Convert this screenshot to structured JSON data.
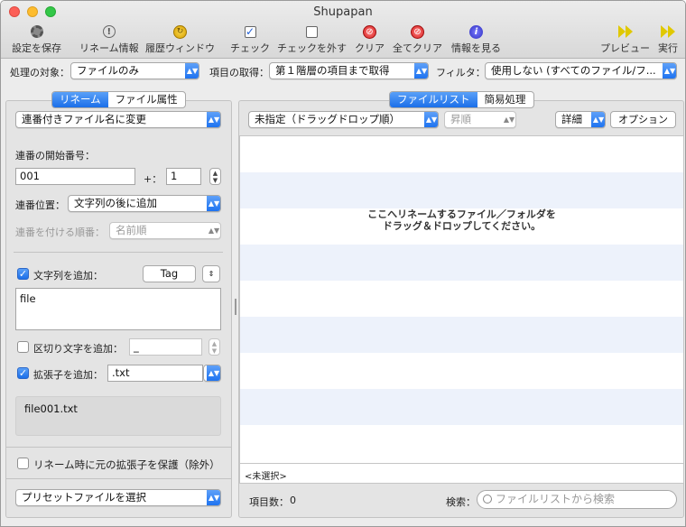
{
  "window": {
    "title": "Shupapan"
  },
  "toolbar": {
    "save_settings": "設定を保存",
    "rename_info": "リネーム情報",
    "history_window": "履歴ウィンドウ",
    "check": "チェック",
    "uncheck": "チェックを外す",
    "clear": "クリア",
    "clear_all": "全てクリア",
    "view_info": "情報を見る",
    "preview": "プレビュー",
    "run": "実行"
  },
  "options_bar": {
    "target_label": "処理の対象：",
    "target_value": "ファイルのみ",
    "fetch_label": "項目の取得：",
    "fetch_value": "第１階層の項目まで取得",
    "filter_label": "フィルタ：",
    "filter_value": "使用しない (すべてのファイル/フ..."
  },
  "left": {
    "tabs": [
      "リネーム",
      "ファイル属性"
    ],
    "active_tab": 0,
    "mode_value": "連番付きファイル名に変更",
    "start_number_label": "連番の開始番号：",
    "start_number_value": "001",
    "plus_label": "+：",
    "increment_value": "1",
    "position_label": "連番位置：",
    "position_value": "文字列の後に追加",
    "order_label": "連番を付ける順番：",
    "order_value": "名前順",
    "add_string_label": "文字列を追加：",
    "add_string_checked": true,
    "tag_button": "Tag",
    "string_value": "file",
    "separator_label": "区切り文字を追加：",
    "separator_checked": false,
    "separator_value": "_",
    "extension_label": "拡張子を追加：",
    "extension_checked": true,
    "extension_value": ".txt",
    "preview_value": "file001.txt",
    "protect_ext_label": "リネーム時に元の拡張子を保護（除外）",
    "protect_ext_checked": false,
    "preset_value": "プリセットファイルを選択"
  },
  "right": {
    "tabs": [
      "ファイルリスト",
      "簡易処理"
    ],
    "active_tab": 0,
    "sort_value": "未指定（ドラッグドロップ順）",
    "order_value": "昇順",
    "view_value": "詳細",
    "options_button": "オプション",
    "drop_hint_line1": "ここへリネームするファイル／フォルダを",
    "drop_hint_line2": "ドラッグ＆ドロップしてください。",
    "selection": "<未選択>",
    "count_label": "項目数：",
    "count_value": "0",
    "search_label": "検索：",
    "search_placeholder": "ファイルリストから検索"
  },
  "colors": {
    "accent": "#1b6fe9",
    "stripe": "#edf2fb"
  }
}
